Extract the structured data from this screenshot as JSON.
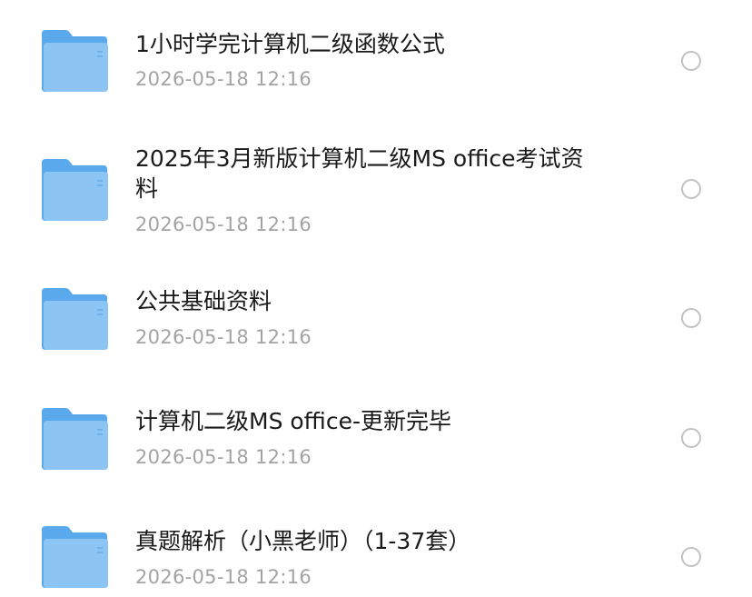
{
  "files": [
    {
      "name": "1小时学完计算机二级函数公式",
      "date": "2026-05-18 12:16",
      "icon": "folder-icon"
    },
    {
      "name": "2025年3月新版计算机二级MS office考试资料",
      "date": "2026-05-18 12:16",
      "icon": "folder-icon"
    },
    {
      "name": "公共基础资料",
      "date": "2026-05-18 12:16",
      "icon": "folder-icon"
    },
    {
      "name": "计算机二级MS office-更新完毕",
      "date": "2026-05-18 12:16",
      "icon": "folder-icon"
    },
    {
      "name": "真题解析（小黑老师）（1-37套）",
      "date": "2026-05-18 12:16",
      "icon": "folder-icon"
    }
  ],
  "colors": {
    "folder_back": "#5aa9ec",
    "folder_front": "#8cc4f4",
    "text": "#1a1a1a",
    "date_text": "#a3a3a3",
    "radio_border": "#c2c2c2"
  }
}
